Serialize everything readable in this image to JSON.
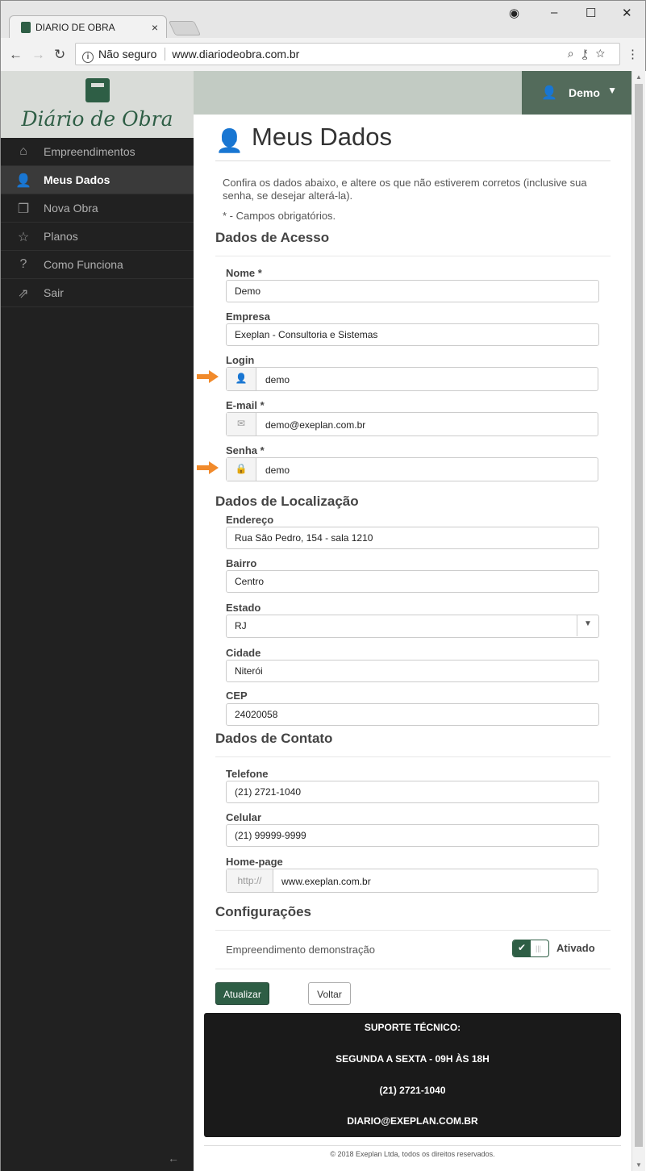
{
  "browser": {
    "tab_title": "DIARIO DE OBRA",
    "tab_close": "×",
    "security_label": "Não seguro",
    "url": "www.diariodeobra.com.br"
  },
  "sidebar": {
    "logo_text": "Diário de Obra",
    "items": [
      {
        "label": "Empreendimentos",
        "icon": "home-icon",
        "glyph": "⌂",
        "active": false
      },
      {
        "label": "Meus Dados",
        "icon": "user-icon",
        "glyph": "👤",
        "active": true
      },
      {
        "label": "Nova Obra",
        "icon": "new-project-icon",
        "glyph": "❐",
        "active": false
      },
      {
        "label": "Planos",
        "icon": "star-icon",
        "glyph": "☆",
        "active": false
      },
      {
        "label": "Como Funciona",
        "icon": "question-icon",
        "glyph": "?",
        "active": false
      },
      {
        "label": "Sair",
        "icon": "logout-icon",
        "glyph": "⇗",
        "active": false
      }
    ]
  },
  "header": {
    "user_name": "Demo"
  },
  "page": {
    "title": "Meus Dados",
    "intro": "Confira os dados abaixo, e altere os que não estiverem corretos (inclusive sua senha, se desejar alterá-la).",
    "required_note": "* - Campos obrigatórios."
  },
  "sections": {
    "access": "Dados de Acesso",
    "location": "Dados de Localização",
    "contact": "Dados de Contato",
    "config": "Configurações"
  },
  "fields": {
    "nome": {
      "label": "Nome *",
      "value": "Demo"
    },
    "empresa": {
      "label": "Empresa",
      "value": "Exeplan - Consultoria e Sistemas"
    },
    "login": {
      "label": "Login",
      "value": "demo"
    },
    "email": {
      "label": "E-mail *",
      "value": "demo@exeplan.com.br"
    },
    "senha": {
      "label": "Senha *",
      "value": "demo"
    },
    "endereco": {
      "label": "Endereço",
      "value": "Rua São Pedro, 154 - sala 1210"
    },
    "bairro": {
      "label": "Bairro",
      "value": "Centro"
    },
    "estado": {
      "label": "Estado",
      "value": "RJ"
    },
    "cidade": {
      "label": "Cidade",
      "value": "Niterói"
    },
    "cep": {
      "label": "CEP",
      "value": "24020058"
    },
    "telefone": {
      "label": "Telefone",
      "value": "(21) 2721-1040"
    },
    "celular": {
      "label": "Celular",
      "value": "(21) 99999-9999"
    },
    "homepage": {
      "label": "Home-page",
      "prefix": "http://",
      "value": "www.exeplan.com.br"
    }
  },
  "config": {
    "label": "Empreendimento demonstração",
    "state": "Ativado",
    "enabled": true
  },
  "buttons": {
    "update": "Atualizar",
    "back": "Voltar"
  },
  "support": {
    "line1": "SUPORTE TÉCNICO:",
    "line2": "SEGUNDA A SEXTA - 09H ÀS 18H",
    "line3": "(21) 2721-1040",
    "line4": "DIARIO@EXEPLAN.COM.BR"
  },
  "footer": "© 2018 Exeplan Ltda, todos os direitos reservados.",
  "colors": {
    "brand": "#2e5e45",
    "sidebar": "#212121",
    "arrow": "#f18a2b"
  }
}
